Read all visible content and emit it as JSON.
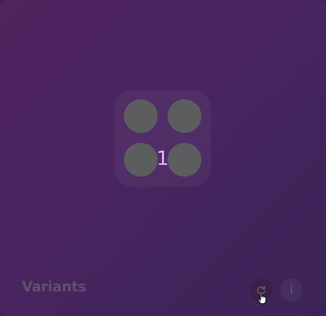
{
  "card": {
    "title": "Variants",
    "variant_count": "1"
  },
  "actions": {
    "refresh_icon": "refresh-icon",
    "info_icon": "info-icon",
    "info_glyph": "i"
  },
  "colors": {
    "background_start": "#4f245f",
    "background_end": "#3c2357",
    "dot": "#5b5d5f",
    "count": "#e9b3f2",
    "title": "#5f4f6d"
  }
}
